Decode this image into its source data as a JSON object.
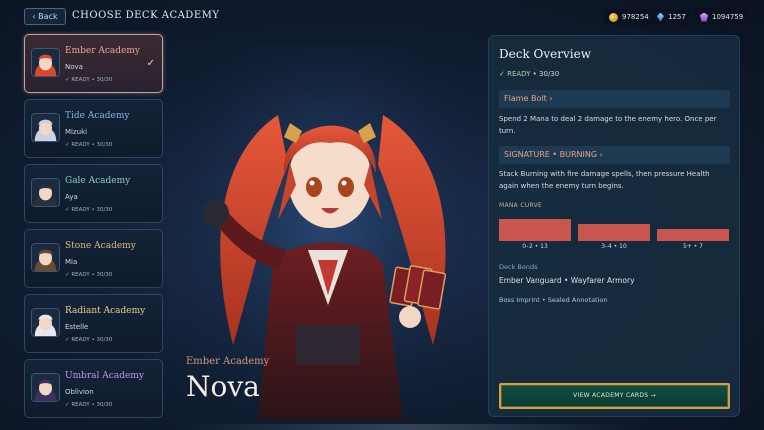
{
  "topbar": {
    "back_label": "‹ Back",
    "title": "CHOOSE DECK ACADEMY",
    "currencies": [
      {
        "icon": "gold-coin-icon",
        "value": "978254"
      },
      {
        "icon": "blue-gem-icon",
        "value": "1257"
      },
      {
        "icon": "purple-crystal-icon",
        "value": "1094759"
      }
    ]
  },
  "academies": [
    {
      "name": "Ember Academy",
      "hero": "Nova",
      "status": "✓ READY  •  30/30",
      "selected": true,
      "name_color": "#e7a894",
      "hair": "#d9482e",
      "check": "✓"
    },
    {
      "name": "Tide Academy",
      "hero": "Mizuki",
      "status": "✓ READY  •  30/30",
      "selected": false,
      "name_color": "#7fb8e8",
      "hair": "#c9d3e6"
    },
    {
      "name": "Gale Academy",
      "hero": "Aya",
      "status": "✓ READY  •  30/30",
      "selected": false,
      "name_color": "#7fd0c8",
      "hair": "#2a2f3d"
    },
    {
      "name": "Stone Academy",
      "hero": "Mia",
      "status": "✓ READY  •  30/30",
      "selected": false,
      "name_color": "#d9b98a",
      "hair": "#6b4a2e"
    },
    {
      "name": "Radiant Academy",
      "hero": "Estelle",
      "status": "✓ READY  •  30/30",
      "selected": false,
      "name_color": "#e8d28a",
      "hair": "#e8e8ee"
    },
    {
      "name": "Umbral Academy",
      "hero": "Oblivion",
      "status": "✓ READY  •  30/30",
      "selected": false,
      "name_color": "#b59ae8",
      "hair": "#3c3060"
    }
  ],
  "hero": {
    "academy": "Ember Academy",
    "name": "Nova"
  },
  "overview": {
    "title": "Deck Overview",
    "status_ready": "✓ READY",
    "status_count": "  •  30/30",
    "ability1_title": "Flame Bolt  ›",
    "ability1_desc": "Spend 2 Mana to deal 2 damage to the enemy hero. Once per turn.",
    "ability2_title": "SIGNATURE  •  BURNING  ›",
    "ability2_desc": "Stack Burning with fire damage spells, then pressure Health again when the enemy turn begins.",
    "mana_label": "MANA CURVE",
    "mana_curve": [
      {
        "label": "0–2  •  13",
        "count": 13
      },
      {
        "label": "3–4  •  10",
        "count": 10
      },
      {
        "label": "5+  •  7",
        "count": 7
      }
    ],
    "bonds_label": "Deck Bonds",
    "bonds": "Ember Vanguard  •  Wayfarer Armory",
    "extras": "Boss Imprint  •  Sealed Annotation",
    "view_button": "VIEW ACADEMY CARDS →"
  }
}
